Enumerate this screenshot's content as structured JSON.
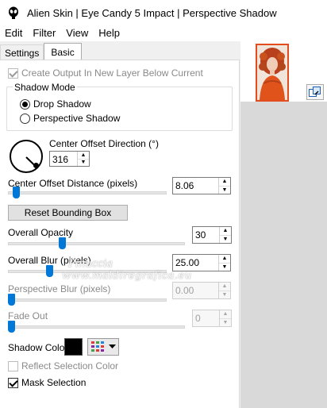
{
  "window": {
    "title": "Alien Skin | Eye Candy 5 Impact | Perspective Shadow",
    "app_icon": "alien-skin-icon"
  },
  "menubar": {
    "items": [
      "Edit",
      "Filter",
      "View",
      "Help"
    ]
  },
  "tabs": [
    {
      "label": "Settings",
      "active": false
    },
    {
      "label": "Basic",
      "active": true
    }
  ],
  "basic": {
    "create_output_label": "Create Output In New Layer Below Current",
    "create_output_checked": true,
    "create_output_enabled": false,
    "shadow_mode": {
      "legend": "Shadow Mode",
      "options": [
        {
          "label": "Drop Shadow",
          "selected": true
        },
        {
          "label": "Perspective Shadow",
          "selected": false
        }
      ]
    },
    "center_offset_direction": {
      "label": "Center Offset Direction (°)",
      "value": "316",
      "angle_degrees": 316
    },
    "center_offset_distance": {
      "label": "Center Offset Distance (pixels)",
      "value": "8.06",
      "slider_fraction": 0.03
    },
    "reset_bounding_box_label": "Reset Bounding Box",
    "overall_opacity": {
      "label": "Overall Opacity",
      "value": "30",
      "slider_fraction": 0.3
    },
    "overall_blur": {
      "label": "Overall Blur (pixels)",
      "value": "25.00",
      "slider_fraction": 0.25
    },
    "perspective_blur": {
      "label": "Perspective Blur (pixels)",
      "value": "0.00",
      "enabled": false,
      "slider_fraction": 0.0
    },
    "fade_out": {
      "label": "Fade Out",
      "value": "0",
      "enabled": false,
      "slider_fraction": 0.0
    },
    "shadow_color": {
      "label": "Shadow Color",
      "color": "#000000"
    },
    "reflect_selection_color": {
      "label": "Reflect Selection Color",
      "checked": false,
      "enabled": false
    },
    "mask_selection": {
      "label": "Mask Selection",
      "checked": true
    }
  },
  "preview": {
    "toggle_icon": "preview-toggle-icon"
  },
  "watermark": {
    "line1": "Pinuccia",
    "line2": "www.maldiregrafica.eu"
  },
  "colors": {
    "accent": "#0078d7",
    "thumbnail_border": "#e34c1c"
  }
}
